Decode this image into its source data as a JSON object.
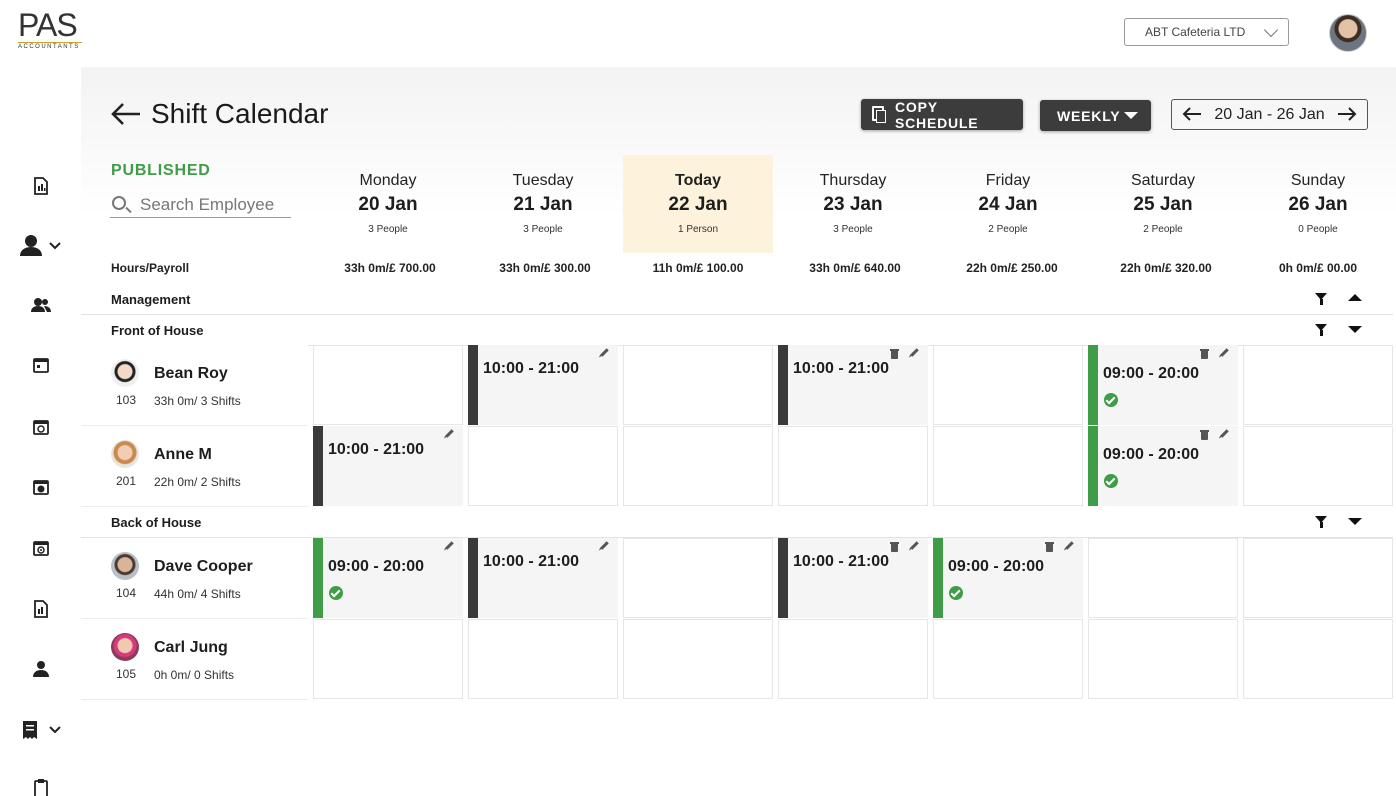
{
  "app": {
    "logo_text": "PAS",
    "logo_sub": "ACCOUNTANTS",
    "company": "ABT Cafeteria LTD"
  },
  "sidebar": {
    "icons": [
      "menu-icon",
      "report-icon",
      "person-icon",
      "people-icon",
      "calendar-icon",
      "calendar-clock-icon",
      "calendar-check-icon",
      "calendar-sync-icon",
      "report-chart-icon",
      "user-icon",
      "receipt-icon",
      "clipboard-icon"
    ]
  },
  "header": {
    "title": "Shift Calendar",
    "copy_label": "COPY SCHEDULE",
    "view_label": "WEEKLY",
    "date_range": "20 Jan - 26 Jan"
  },
  "filters": {
    "status": "PUBLISHED",
    "search_placeholder": "Search Employee"
  },
  "days": [
    {
      "name": "Monday",
      "date": "20 Jan",
      "people": "3 People",
      "hours": "33h 0m/£ 700.00"
    },
    {
      "name": "Tuesday",
      "date": "21 Jan",
      "people": "3 People",
      "hours": "33h 0m/£ 300.00"
    },
    {
      "name": "Today",
      "date": "22 Jan",
      "people": "1 Person",
      "hours": "11h 0m/£ 100.00"
    },
    {
      "name": "Thursday",
      "date": "23 Jan",
      "people": "3 People",
      "hours": "33h 0m/£ 640.00"
    },
    {
      "name": "Friday",
      "date": "24 Jan",
      "people": "2 People",
      "hours": "22h 0m/£ 250.00"
    },
    {
      "name": "Saturday",
      "date": "25 Jan",
      "people": "2 People",
      "hours": "22h 0m/£ 320.00"
    },
    {
      "name": "Sunday",
      "date": "26 Jan",
      "people": "0 People",
      "hours": "0h 0m/£ 00.00"
    }
  ],
  "hours_label": "Hours/Payroll",
  "groups": {
    "management": "Management",
    "front": "Front of House",
    "back": "Back of House"
  },
  "employees": [
    {
      "name": "Bean Roy",
      "id": "103",
      "meta": "33h 0m/ 3 Shifts"
    },
    {
      "name": "Anne M",
      "id": "201",
      "meta": "22h 0m/ 2 Shifts"
    },
    {
      "name": "Dave Cooper",
      "id": "104",
      "meta": "44h 0m/ 4 Shifts"
    },
    {
      "name": "Carl Jung",
      "id": "105",
      "meta": "0h 0m/ 0 Shifts"
    }
  ],
  "shifts": {
    "s1": "10:00 - 21:00",
    "s2": "10:00 - 21:00",
    "s3": "09:00 - 20:00",
    "s4": "10:00 - 21:00",
    "s5": "09:00 - 20:00",
    "s6": "09:00 - 20:00",
    "s7": "10:00 - 21:00",
    "s8": "10:00 - 21:00",
    "s9": "09:00 - 20:00"
  },
  "colors": {
    "published_green": "#3f9c47",
    "today_bg": "#fdf3dc",
    "button_dark": "#3c3c3c"
  }
}
